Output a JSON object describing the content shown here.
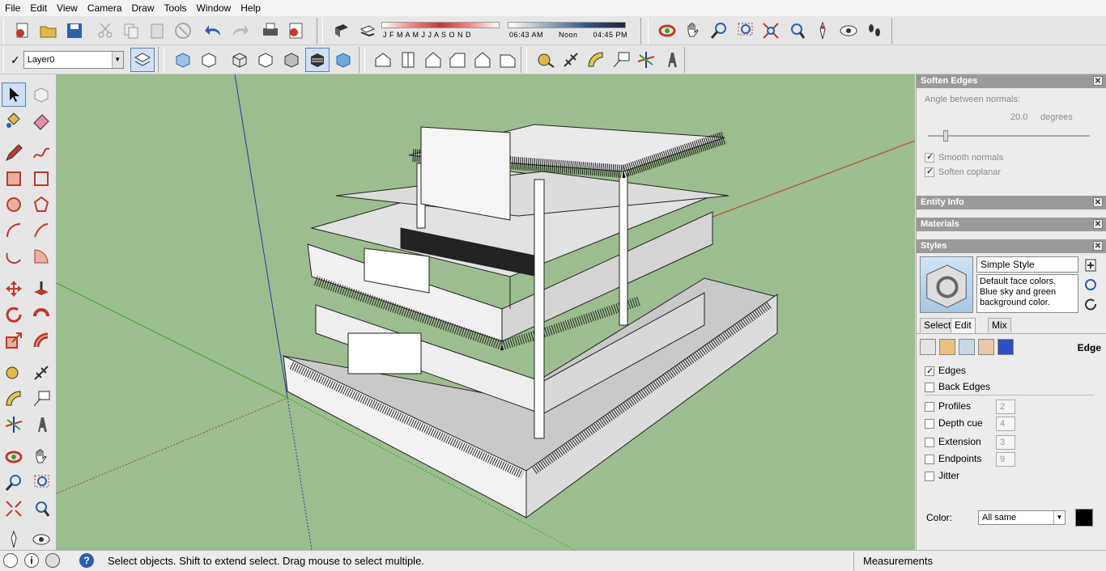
{
  "menu": [
    "File",
    "Edit",
    "View",
    "Camera",
    "Draw",
    "Tools",
    "Window",
    "Help"
  ],
  "shadow": {
    "months": "J F M A M J J A S O N D",
    "time_start": "06:43 AM",
    "time_mid": "Noon",
    "time_end": "04:45 PM"
  },
  "layer": {
    "name": "Layer0"
  },
  "status": {
    "message": "Select objects. Shift to extend select. Drag mouse to select multiple.",
    "measurements_label": "Measurements"
  },
  "soften_edges": {
    "title": "Soften Edges",
    "angle_label": "Angle between normals:",
    "angle_value": "20.0",
    "angle_unit": "degrees",
    "slider_fraction": 0.11,
    "smooth_normals": "Smooth normals",
    "soften_coplanar": "Soften coplanar"
  },
  "panels": {
    "entity_info": "Entity Info",
    "materials": "Materials",
    "styles": "Styles"
  },
  "styles": {
    "name": "Simple Style",
    "description": "Default face colors. Blue sky and green background color.",
    "tabs": [
      "Select",
      "Edit",
      "Mix"
    ],
    "active_tab": "Edit",
    "section": "Edge",
    "options": [
      {
        "label": "Edges",
        "checked": true,
        "value": ""
      },
      {
        "label": "Back Edges",
        "checked": false,
        "value": ""
      },
      {
        "label": "Profiles",
        "checked": false,
        "value": "2"
      },
      {
        "label": "Depth cue",
        "checked": false,
        "value": "4"
      },
      {
        "label": "Extension",
        "checked": false,
        "value": "3"
      },
      {
        "label": "Endpoints",
        "checked": false,
        "value": "9"
      },
      {
        "label": "Jitter",
        "checked": false,
        "value": ""
      }
    ],
    "color_label": "Color:",
    "color_value": "All same"
  },
  "colors": {
    "viewport_bg": "#9cbe8f",
    "axis_red": "#c0392b",
    "axis_green": "#2ea52e",
    "axis_blue": "#2438a8",
    "panel_header": "#9a9a9a"
  }
}
